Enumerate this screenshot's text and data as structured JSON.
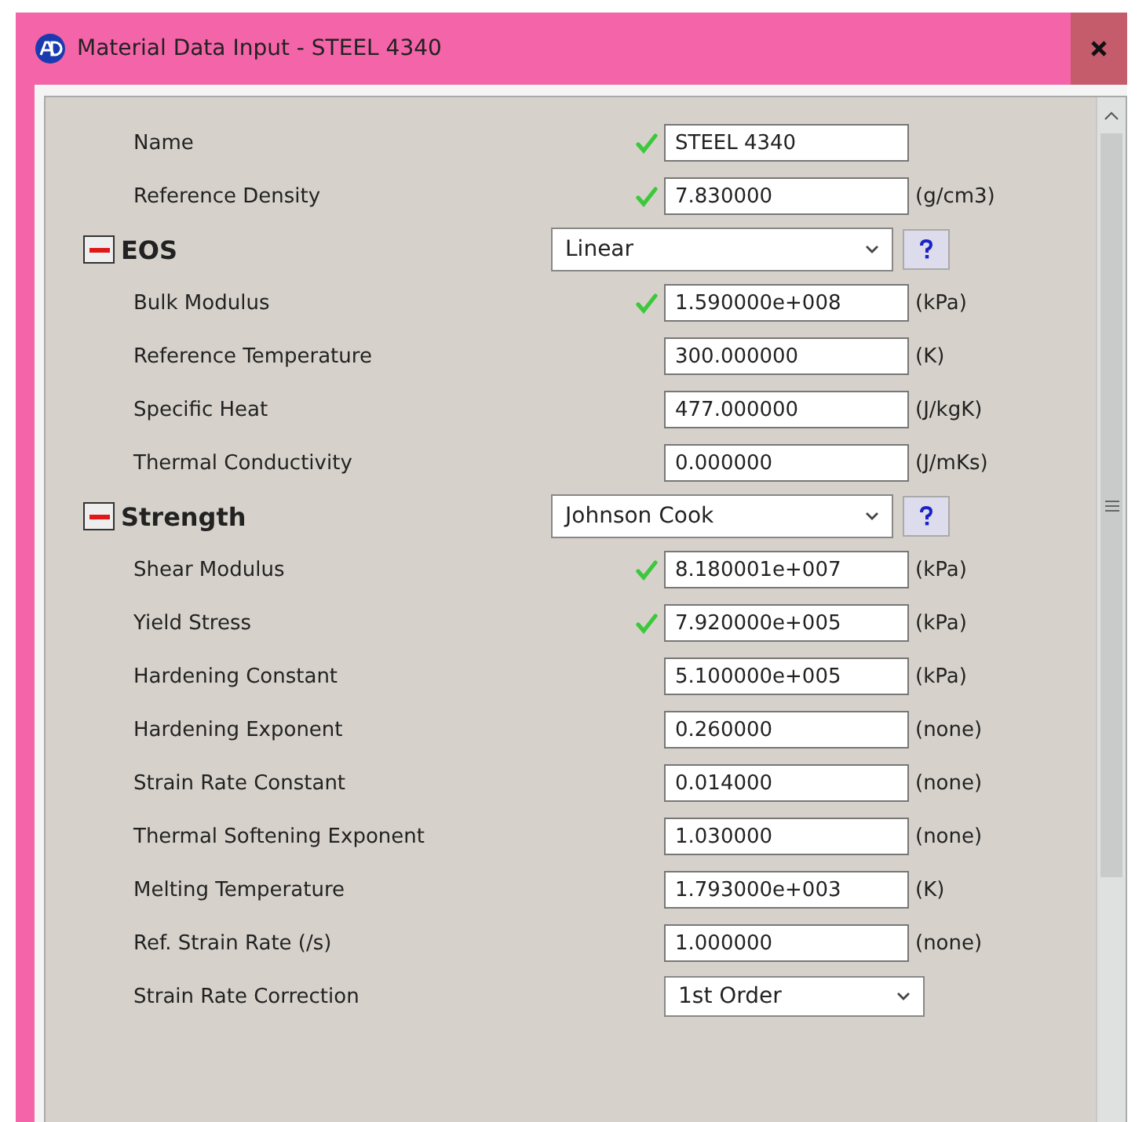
{
  "window": {
    "title": "Material Data Input - STEEL 4340"
  },
  "fields": [
    {
      "label": "Name",
      "kind": "input",
      "validated": true,
      "value": "STEEL 4340"
    },
    {
      "label": "Reference Density",
      "kind": "input",
      "validated": true,
      "value": "7.830000",
      "unit": "(g/cm3)"
    }
  ],
  "sections": [
    {
      "title": "EOS",
      "expanded": true,
      "model": "Linear",
      "rows": [
        {
          "label": "Bulk Modulus",
          "kind": "input",
          "validated": true,
          "value": "1.590000e+008",
          "unit": "(kPa)"
        },
        {
          "label": "Reference Temperature",
          "kind": "input",
          "validated": false,
          "value": "300.000000",
          "unit": "(K)"
        },
        {
          "label": "Specific Heat",
          "kind": "input",
          "validated": false,
          "value": "477.000000",
          "unit": "(J/kgK)"
        },
        {
          "label": "Thermal Conductivity",
          "kind": "input",
          "validated": false,
          "value": "0.000000",
          "unit": "(J/mKs)"
        }
      ]
    },
    {
      "title": "Strength",
      "expanded": true,
      "model": "Johnson Cook",
      "rows": [
        {
          "label": "Shear Modulus",
          "kind": "input",
          "validated": true,
          "value": "8.180001e+007",
          "unit": "(kPa)"
        },
        {
          "label": "Yield Stress",
          "kind": "input",
          "validated": true,
          "value": "7.920000e+005",
          "unit": "(kPa)"
        },
        {
          "label": "Hardening Constant",
          "kind": "input",
          "validated": false,
          "value": "5.100000e+005",
          "unit": "(kPa)"
        },
        {
          "label": "Hardening Exponent",
          "kind": "input",
          "validated": false,
          "value": "0.260000",
          "unit": "(none)"
        },
        {
          "label": "Strain Rate Constant",
          "kind": "input",
          "validated": false,
          "value": "0.014000",
          "unit": "(none)"
        },
        {
          "label": "Thermal Softening Exponent",
          "kind": "input",
          "validated": false,
          "value": "1.030000",
          "unit": "(none)"
        },
        {
          "label": "Melting Temperature",
          "kind": "input",
          "validated": false,
          "value": "1.793000e+003",
          "unit": "(K)"
        },
        {
          "label": "Ref. Strain Rate (/s)",
          "kind": "input",
          "validated": false,
          "value": "1.000000",
          "unit": "(none)"
        },
        {
          "label": "Strain Rate Correction",
          "kind": "select",
          "validated": false,
          "value": "1st Order"
        }
      ]
    }
  ]
}
